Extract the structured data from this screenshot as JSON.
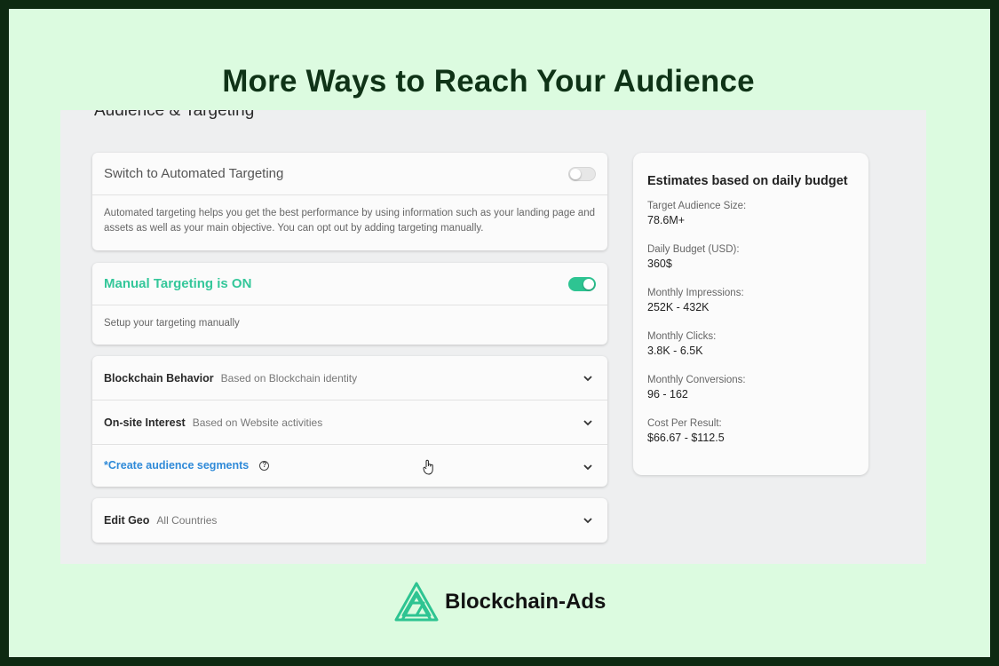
{
  "headline": "More Ways to Reach Your Audience",
  "section_title": "Audience & Targeting",
  "automated": {
    "title": "Switch to Automated Targeting",
    "enabled": false,
    "description": "Automated targeting helps you get the best performance by using information such as your landing page and assets as well as your main objective. You can opt out by adding targeting manually."
  },
  "manual": {
    "title": "Manual Targeting is ON",
    "enabled": true,
    "description": "Setup your targeting manually"
  },
  "targeting_rows": [
    {
      "label": "Blockchain Behavior",
      "sub": "Based on Blockchain identity"
    },
    {
      "label": "On-site Interest",
      "sub": "Based on Website activities"
    },
    {
      "label": "*Create audience segments",
      "sub": ""
    }
  ],
  "geo": {
    "label": "Edit Geo",
    "sub": "All Countries"
  },
  "estimates": {
    "title": "Estimates based on daily budget",
    "metrics": [
      {
        "label": "Target Audience Size:",
        "value": "78.6M+"
      },
      {
        "label": "Daily Budget (USD):",
        "value": "360$"
      },
      {
        "label": "Monthly Impressions:",
        "value": "252K - 432K"
      },
      {
        "label": "Monthly Clicks:",
        "value": "3.8K - 6.5K"
      },
      {
        "label": "Monthly Conversions:",
        "value": "96 - 162"
      },
      {
        "label": "Cost Per Result:",
        "value": "$66.67 - $112.5"
      }
    ]
  },
  "brand": {
    "name": "Blockchain-Ads",
    "accent": "#2ec492"
  }
}
